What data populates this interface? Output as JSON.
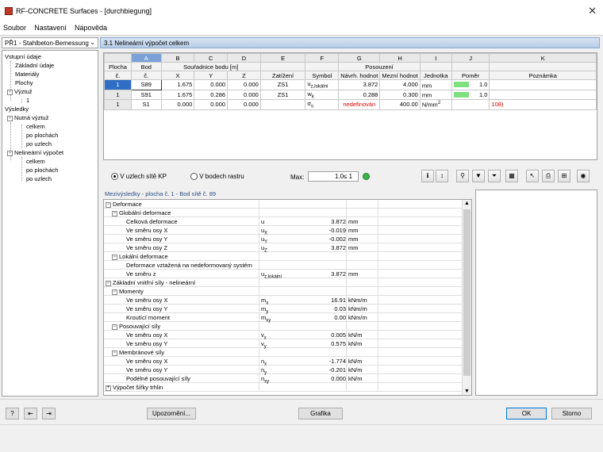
{
  "window": {
    "title": "RF-CONCRETE Surfaces - [durchbiegung]",
    "close": "✕"
  },
  "menu": [
    "Soubor",
    "Nastavení",
    "Nápověda"
  ],
  "case_combo": {
    "value": "PŘ1 - Stahlbeton-Bemessung"
  },
  "section_title": "3.1 Nelineární výpočet celkem",
  "tree": [
    {
      "label": "Vstupní údaje",
      "level": 0
    },
    {
      "label": "Základní údaje",
      "level": 1
    },
    {
      "label": "Materiály",
      "level": 1
    },
    {
      "label": "Plochy",
      "level": 1
    },
    {
      "label": "Výztuž",
      "level": 1,
      "toggle": "−"
    },
    {
      "label": "1",
      "level": 2
    },
    {
      "label": "Výsledky",
      "level": 0
    },
    {
      "label": "Nutná výztuž",
      "level": 1,
      "toggle": "−"
    },
    {
      "label": "celkem",
      "level": 2
    },
    {
      "label": "po plochách",
      "level": 2
    },
    {
      "label": "po uzlech",
      "level": 2
    },
    {
      "label": "Nelineární výpočet",
      "level": 1,
      "toggle": "−"
    },
    {
      "label": "celkem",
      "level": 2
    },
    {
      "label": "po plochách",
      "level": 2
    },
    {
      "label": "po uzlech",
      "level": 2
    }
  ],
  "grid": {
    "col_letters": [
      "A",
      "B",
      "C",
      "D",
      "E",
      "F",
      "G",
      "H",
      "I",
      "J",
      "K"
    ],
    "hdr1": {
      "plocha": "Plocha",
      "bod": "Bod",
      "coords": "Souřadnice bodu [m]",
      "posouzeni": "Posouzení"
    },
    "hdr2": {
      "plocha": "č.",
      "bod": "č.",
      "x": "X",
      "y": "Y",
      "z": "Z",
      "zatizeni": "Zatížení",
      "symbol": "Symbol",
      "navrh": "Návrh. hodnot",
      "mezni": "Mezní hodnot",
      "jednotka": "Jednotka",
      "pomer": "Poměr",
      "poznamka": "Poznámka"
    },
    "rows": [
      {
        "plocha": "1",
        "bod": "S89",
        "x": "1.675",
        "y": "0.000",
        "z": "0.000",
        "zat": "ZS1",
        "sym": "u",
        "sub": "z,lokální",
        "navrh": "3.872",
        "mezni": "4.000",
        "unit": "mm",
        "sup": "",
        "pomer": "1.0",
        "ratio_fill": 0.97,
        "pozn": ""
      },
      {
        "plocha": "1",
        "bod": "S91",
        "x": "1.675",
        "y": "0.286",
        "z": "0.000",
        "zat": "ZS1",
        "sym": "w",
        "sub": "k",
        "navrh": "0.288",
        "mezni": "0.300",
        "unit": "mm",
        "sup": "",
        "pomer": "1.0",
        "ratio_fill": 0.96,
        "pozn": ""
      },
      {
        "plocha": "1",
        "bod": "S1",
        "x": "0.000",
        "y": "0.000",
        "z": "0.000",
        "zat": "",
        "sym": "σ",
        "sub": "s",
        "navrh": "nedefinován",
        "mezni": "400.00",
        "unit": "N/mm",
        "sup": "2",
        "pomer": "",
        "ratio_fill": 0,
        "pozn": "108)"
      }
    ]
  },
  "options": {
    "radio1": "V uzlech sítě KP",
    "radio2": "V bodech rastru",
    "max_label": "Max:",
    "max_value": "1.0",
    "max_cond": "≤ 1"
  },
  "intermediate": {
    "header": "Mezivýsledky  -  plocha č. 1 - Bod sítě č. 89",
    "rows": [
      {
        "label": "Deformace",
        "indent": 0,
        "toggle": "−"
      },
      {
        "label": "Globální deformace",
        "indent": 1,
        "toggle": "−"
      },
      {
        "label": "Celková deformace",
        "indent": 2,
        "sym": "u",
        "sub": "",
        "val": "3.872",
        "unit": "mm"
      },
      {
        "label": "Ve směru osy X",
        "indent": 2,
        "sym": "u",
        "sub": "X",
        "val": "-0.019",
        "unit": "mm"
      },
      {
        "label": "Ve směru osy Y",
        "indent": 2,
        "sym": "u",
        "sub": "Y",
        "val": "-0.002",
        "unit": "mm"
      },
      {
        "label": "Ve směru osy Z",
        "indent": 2,
        "sym": "u",
        "sub": "Z",
        "val": "3.872",
        "unit": "mm"
      },
      {
        "label": "Lokální deformace",
        "indent": 1,
        "toggle": "−"
      },
      {
        "label": "Deformace vztažená na nedeformovaný systém",
        "indent": 2
      },
      {
        "label": "Ve směru z",
        "indent": 2,
        "sym": "u",
        "sub": "z,lokální",
        "val": "3.872",
        "unit": "mm"
      },
      {
        "label": "Základní vnitřní síly - nelineární",
        "indent": 0,
        "toggle": "−"
      },
      {
        "label": "Momenty",
        "indent": 1,
        "toggle": "−"
      },
      {
        "label": "Ve směru osy X",
        "indent": 2,
        "sym": "m",
        "sub": "x",
        "val": "16.91",
        "unit": "kNm/m"
      },
      {
        "label": "Ve směru osy Y",
        "indent": 2,
        "sym": "m",
        "sub": "y",
        "val": "0.03",
        "unit": "kNm/m"
      },
      {
        "label": "Kroutící moment",
        "indent": 2,
        "sym": "m",
        "sub": "xy",
        "val": "0.00",
        "unit": "kNm/m"
      },
      {
        "label": "Posouvající síly",
        "indent": 1,
        "toggle": "−"
      },
      {
        "label": "Ve směru osy X",
        "indent": 2,
        "sym": "v",
        "sub": "x",
        "val": "0.005",
        "unit": "kN/m"
      },
      {
        "label": "Ve směru osy Y",
        "indent": 2,
        "sym": "v",
        "sub": "y",
        "val": "0.575",
        "unit": "kN/m"
      },
      {
        "label": "Membránové síly",
        "indent": 1,
        "toggle": "−"
      },
      {
        "label": "Ve směru osy X",
        "indent": 2,
        "sym": "n",
        "sub": "x",
        "val": "-1.774",
        "unit": "kN/m"
      },
      {
        "label": "Ve směru osy Y",
        "indent": 2,
        "sym": "n",
        "sub": "y",
        "val": "-0.201",
        "unit": "kN/m"
      },
      {
        "label": "Podélné posouvající síly",
        "indent": 2,
        "sym": "n",
        "sub": "xy",
        "val": "0.000",
        "unit": "kN/m"
      },
      {
        "label": "Výpočet šířky trhlin",
        "indent": 0,
        "toggle": "+"
      }
    ]
  },
  "buttons": {
    "upozorneni": "Upozornění...",
    "grafika": "Grafika",
    "ok": "OK",
    "storno": "Storno"
  },
  "colors": {
    "accent": "#2f6ec4",
    "ratio_green": "#7ee07e",
    "error_red": "#e00000"
  }
}
